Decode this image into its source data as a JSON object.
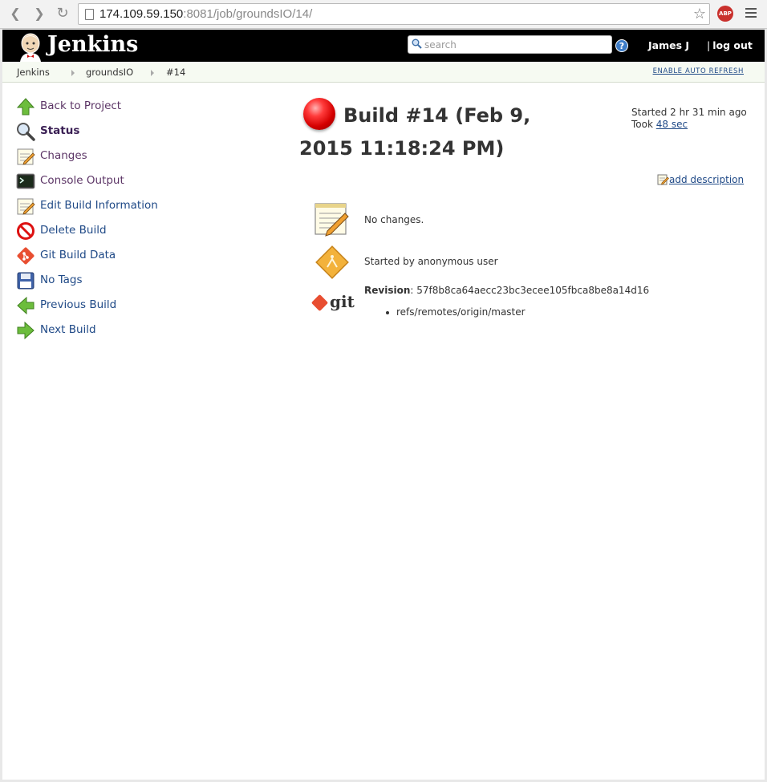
{
  "browser": {
    "url_host": "174.109.59.150",
    "url_path": ":8081/job/groundsIO/14/",
    "abp_label": "ABP"
  },
  "header": {
    "logo_text": "Jenkins",
    "search_placeholder": "search",
    "help_label": "?",
    "user_name": "James J",
    "logout_sep": "|",
    "logout_label": "log out"
  },
  "breadcrumbs": {
    "items": [
      "Jenkins",
      "groundsIO",
      "#14"
    ],
    "auto_refresh": "ENABLE AUTO REFRESH"
  },
  "sidebar": {
    "items": [
      {
        "label": "Back to Project",
        "icon": "up-arrow-icon"
      },
      {
        "label": "Status",
        "icon": "magnifier-icon"
      },
      {
        "label": "Changes",
        "icon": "notepad-icon"
      },
      {
        "label": "Console Output",
        "icon": "terminal-icon"
      },
      {
        "label": "Edit Build Information",
        "icon": "notepad-icon"
      },
      {
        "label": "Delete Build",
        "icon": "no-entry-icon"
      },
      {
        "label": "Git Build Data",
        "icon": "git-icon"
      },
      {
        "label": "No Tags",
        "icon": "floppy-icon"
      },
      {
        "label": "Previous Build",
        "icon": "left-arrow-icon"
      },
      {
        "label": "Next Build",
        "icon": "right-arrow-icon"
      }
    ]
  },
  "build": {
    "title": "Build #14 (Feb 9, 2015 11:18:24 PM)",
    "status_color": "#d40000",
    "started_text": "Started 2 hr 31 min ago",
    "took_prefix": "Took",
    "took_link": "48 sec",
    "add_description": "add description",
    "changes_text": "No changes.",
    "started_by": "Started by anonymous user",
    "revision_label": "Revision",
    "revision_value": ": 57f8b8ca64aecc23bc3ecee105fbca8be8a14d16",
    "git_word": "git",
    "refs": [
      "refs/remotes/origin/master"
    ]
  }
}
